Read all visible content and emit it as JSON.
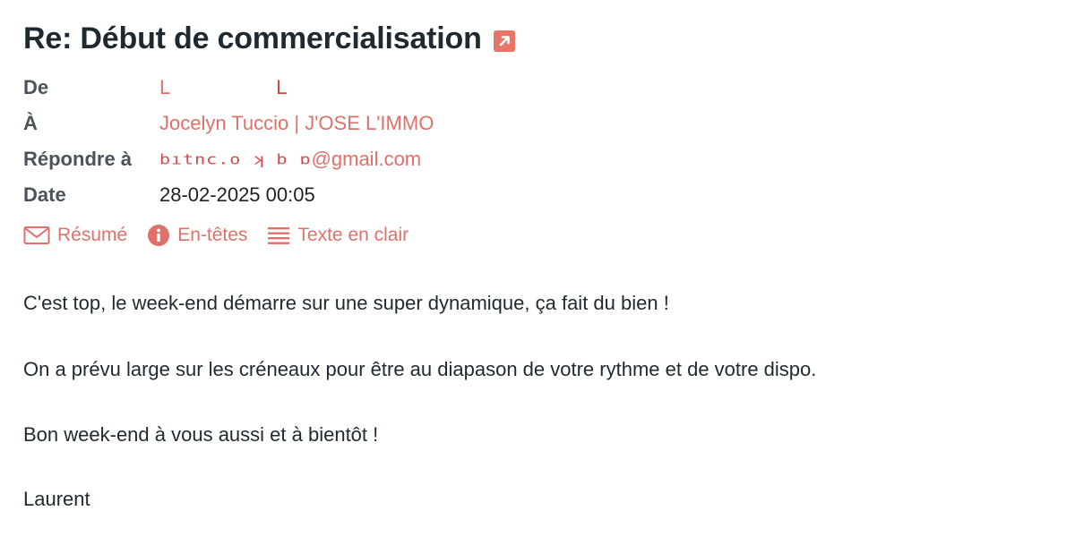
{
  "email": {
    "subject": "Re: Début de commercialisation",
    "headers": {
      "from_label": "De",
      "from_value_a": "L",
      "from_value_b": "L",
      "to_label": "À",
      "to_value": "Jocelyn Tuccio | J'OSE L'IMMO",
      "reply_label": "Répondre à",
      "reply_prefix": "bıtnc.o ʞ  b  ɒ",
      "reply_suffix": "@gmail.com",
      "date_label": "Date",
      "date_value": "28-02-2025 00:05"
    },
    "tabs": [
      {
        "label": "Résumé",
        "icon": "envelope-icon"
      },
      {
        "label": "En-têtes",
        "icon": "info-icon"
      },
      {
        "label": "Texte en clair",
        "icon": "lines-icon"
      }
    ],
    "body": [
      "C'est top, le week-end démarre sur une super dynamique, ça fait du bien !",
      "On a prévu large sur les créneaux pour être au diapason de votre rythme et de votre dispo.",
      "Bon week-end à vous aussi et à bientôt !",
      "Laurent"
    ]
  },
  "colors": {
    "accent": "#e0706a",
    "title": "#1f2a30",
    "label": "#4b5459"
  }
}
